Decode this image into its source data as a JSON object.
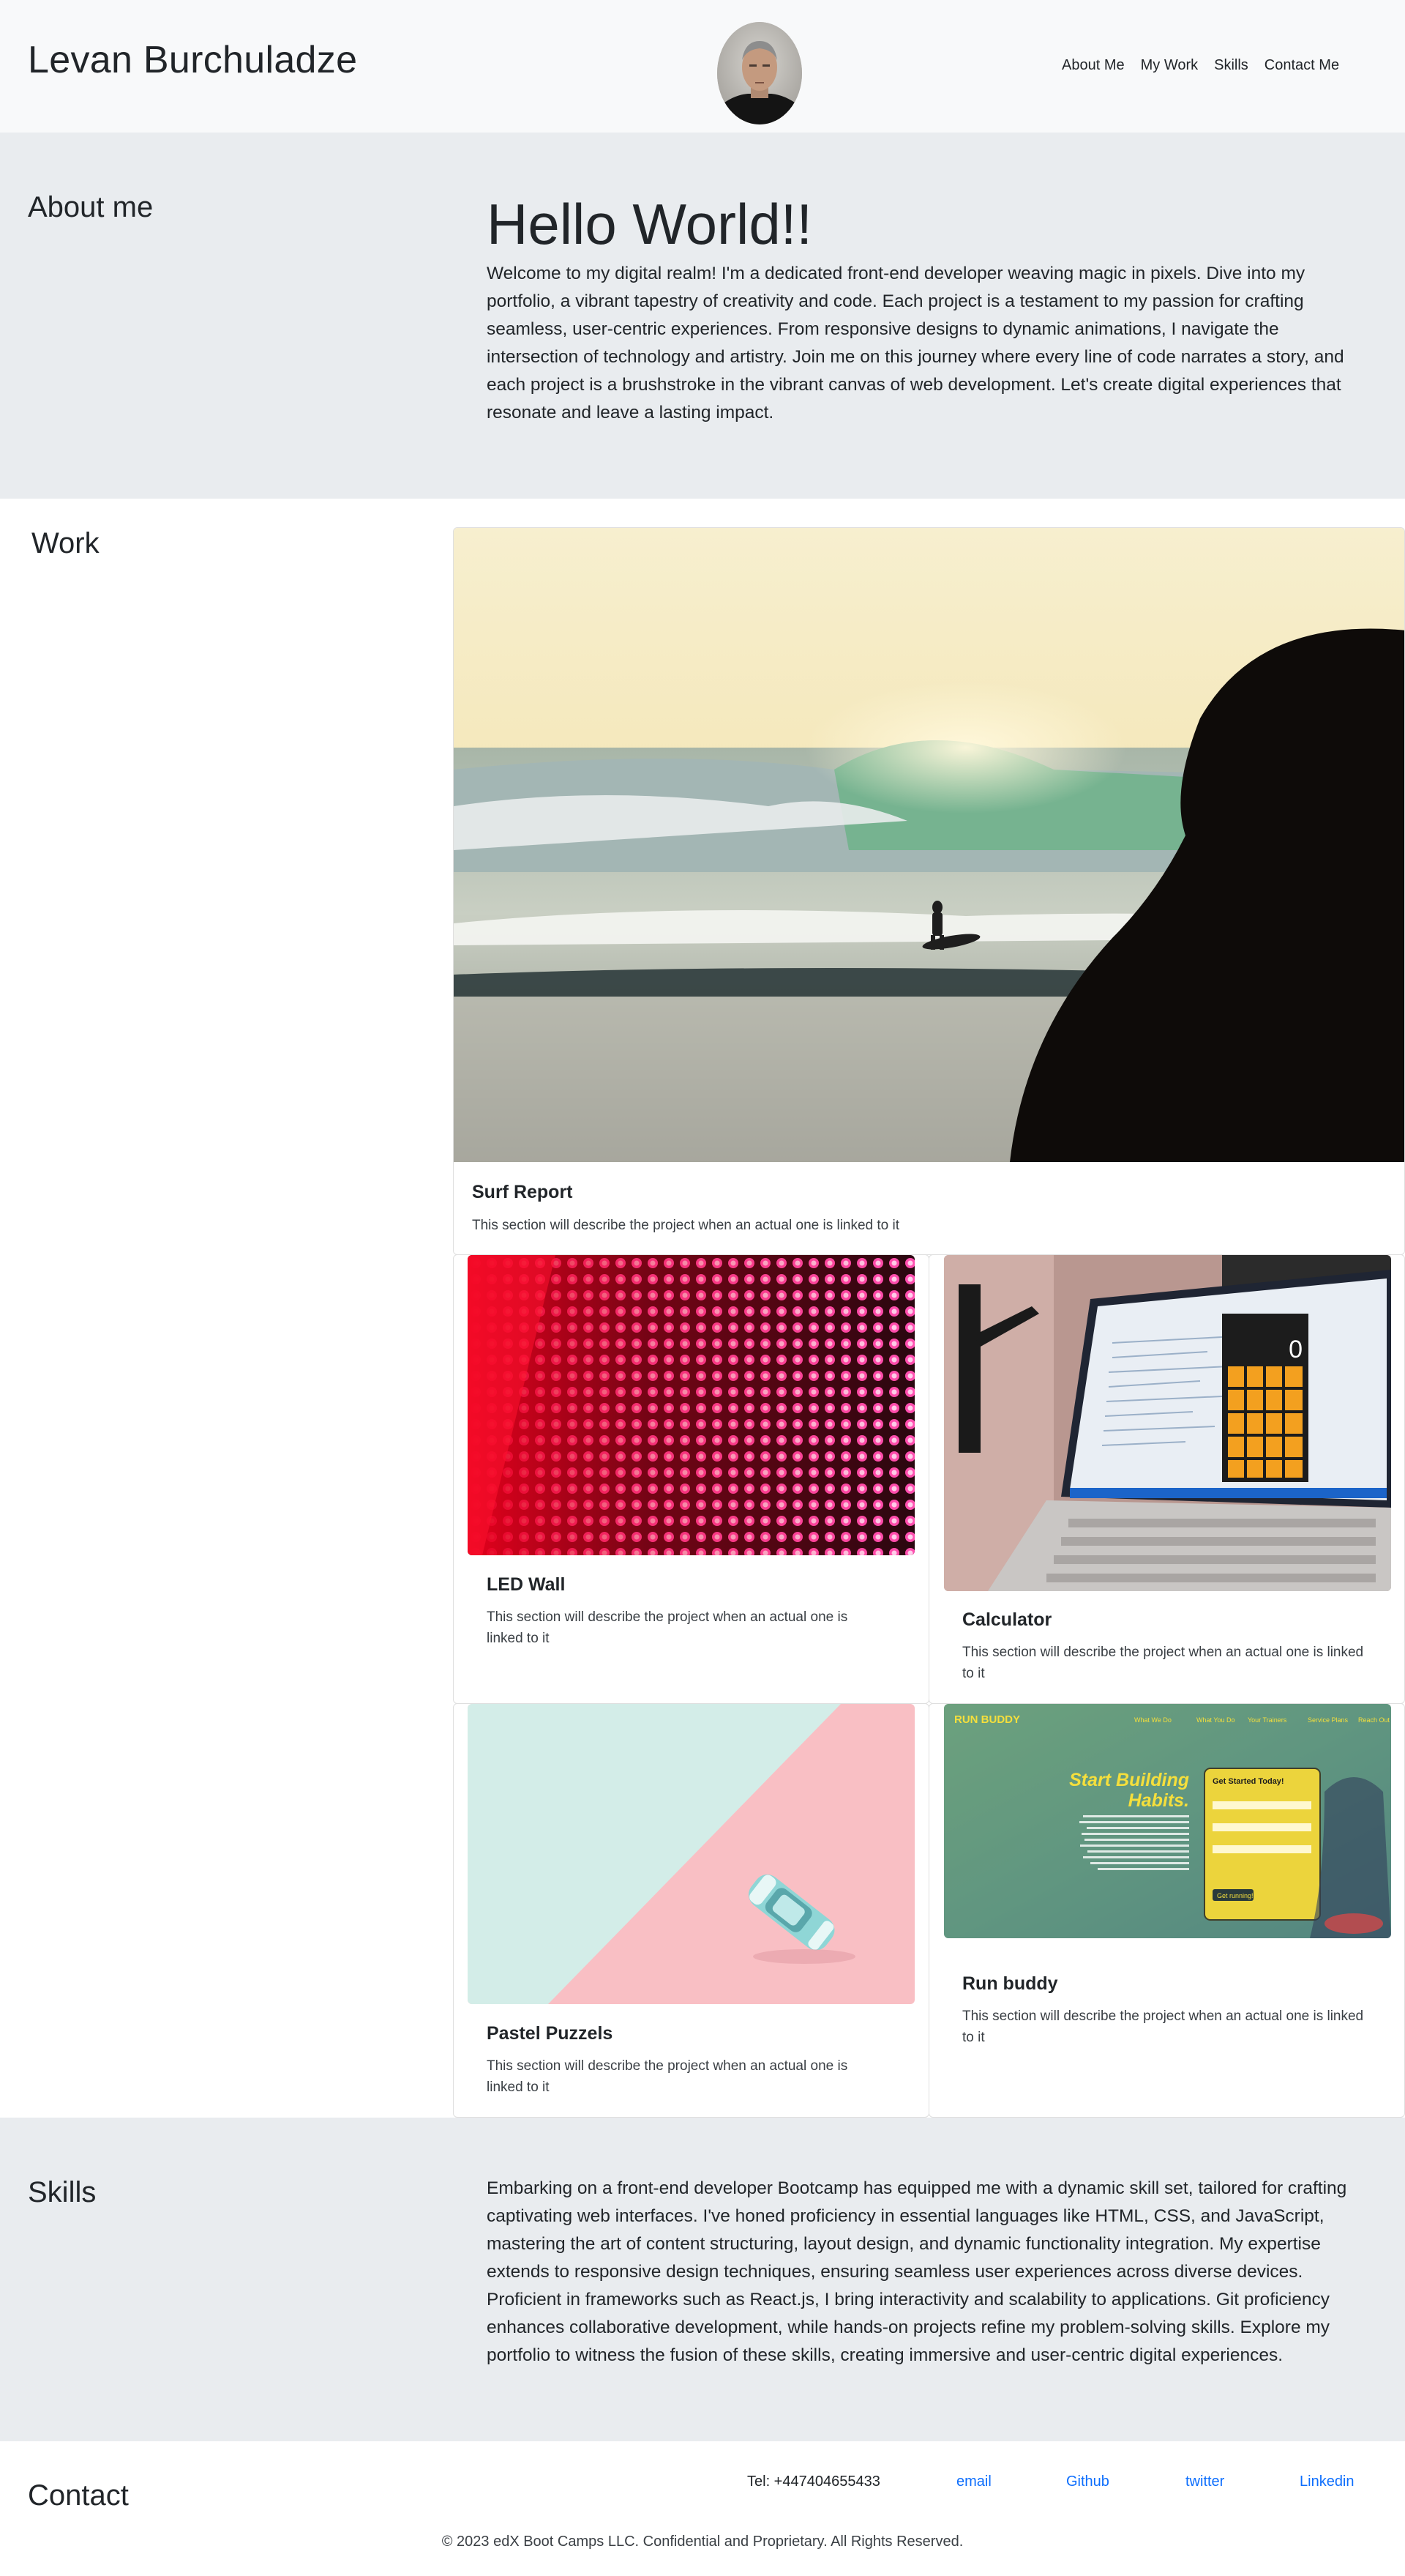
{
  "header": {
    "site_title": "Levan Burchuladze",
    "nav": [
      "About Me",
      "My Work",
      "Skills",
      "Contact Me"
    ]
  },
  "about": {
    "label": "About me",
    "heading": "Hello World!!",
    "text": "Welcome to my digital realm! I'm a dedicated front-end developer weaving magic in pixels. Dive into my portfolio, a vibrant tapestry of creativity and code. Each project is a testament to my passion for crafting seamless, user-centric experiences. From responsive designs to dynamic animations, I navigate the intersection of technology and artistry. Join me on this journey where every line of code narrates a story, and each project is a brushstroke in the vibrant canvas of web development. Let's create digital experiences that resonate and leave a lasting impact."
  },
  "work": {
    "label": "Work",
    "projects": [
      {
        "title": "Surf Report",
        "text": "This section will describe the project when an actual one is linked to it"
      },
      {
        "title": "LED Wall",
        "text": "This section will describe the project when an actual one is linked to it"
      },
      {
        "title": "Calculator",
        "text": "This section will describe the project when an actual one is linked to it"
      },
      {
        "title": "Pastel Puzzels",
        "text": "This section will describe the project when an actual one is linked to it"
      },
      {
        "title": "Run buddy",
        "text": "This section will describe the project when an actual one is linked to it"
      }
    ],
    "runbuddy_screenshot": {
      "brand": "RUN BUDDY",
      "nav": [
        "What We Do",
        "What You Do",
        "Your Trainers",
        "Service Plans",
        "Reach Out"
      ],
      "headline_1": "Start Building",
      "headline_2": "Habits.",
      "form_title": "Get Started Today!",
      "button": "Get running!"
    },
    "calculator_screenshot": {
      "display": "0"
    }
  },
  "skills": {
    "label": "Skills",
    "text": "Embarking on a front-end developer Bootcamp has equipped me with a dynamic skill set, tailored for crafting captivating web interfaces. I've honed proficiency in essential languages like HTML, CSS, and JavaScript, mastering the art of content structuring, layout design, and dynamic functionality integration. My expertise extends to responsive design techniques, ensuring seamless user experiences across diverse devices. Proficient in frameworks such as React.js, I bring interactivity and scalability to applications. Git proficiency enhances collaborative development, while hands-on projects refine my problem-solving skills. Explore my portfolio to witness the fusion of these skills, creating immersive and user-centric digital experiences."
  },
  "contact": {
    "label": "Contact",
    "tel": "Tel: +447404655433",
    "links": [
      "email",
      "Github",
      "twitter",
      "Linkedin"
    ],
    "copyright": "© 2023 edX Boot Camps LLC. Confidential and Proprietary. All Rights Reserved."
  },
  "colors": {
    "header_bg": "#f8f9fa",
    "section_bg": "#e9ecef",
    "link": "#0d6efd",
    "text": "#212529"
  }
}
